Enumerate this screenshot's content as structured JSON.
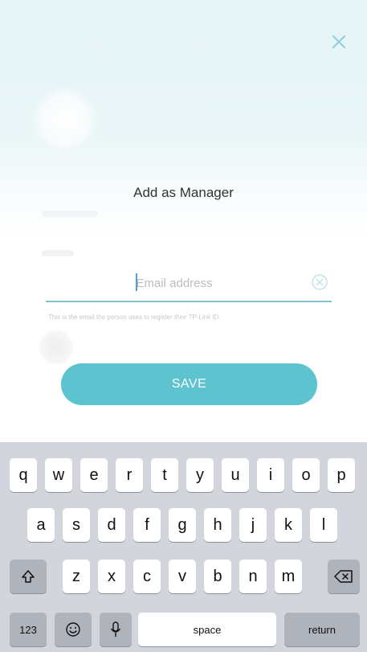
{
  "dialog": {
    "title": "Add as Manager",
    "email_placeholder": "Email address",
    "email_value": "",
    "helper_text": "This is the email the person uses to register their TP-Link ID.",
    "save_label": "SAVE"
  },
  "keyboard": {
    "row1": [
      "q",
      "w",
      "e",
      "r",
      "t",
      "y",
      "u",
      "i",
      "o",
      "p"
    ],
    "row2": [
      "a",
      "s",
      "d",
      "f",
      "g",
      "h",
      "j",
      "k",
      "l"
    ],
    "row3": [
      "z",
      "x",
      "c",
      "v",
      "b",
      "n",
      "m"
    ],
    "numbers_label": "123",
    "space_label": "space",
    "return_label": "return"
  },
  "colors": {
    "accent": "#5cc3cf",
    "close_icon": "#8fd3db",
    "keyboard_bg": "#d2d5db",
    "function_key": "#aeb3bc"
  },
  "icons": {
    "close": "close-icon",
    "clear": "clear-icon",
    "shift": "shift-icon",
    "backspace": "backspace-icon",
    "emoji": "emoji-icon",
    "microphone": "microphone-icon"
  }
}
